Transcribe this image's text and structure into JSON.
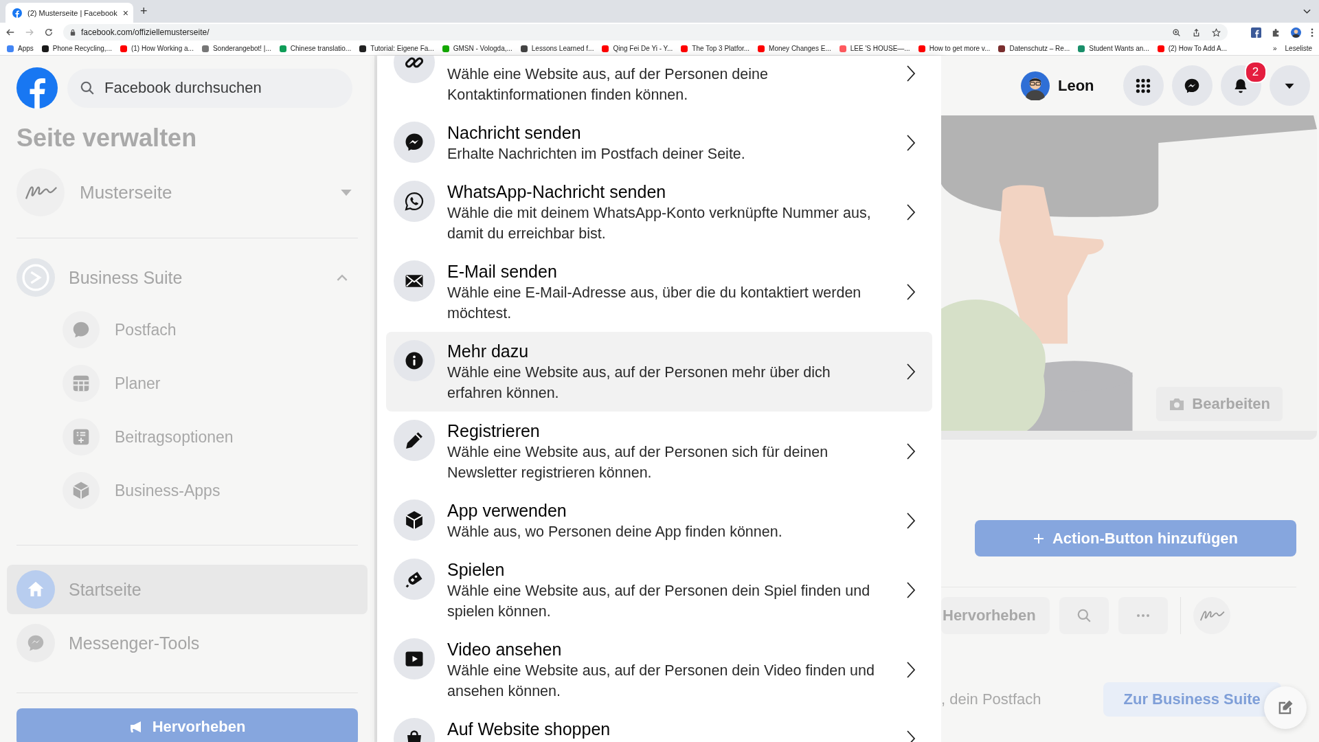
{
  "browser": {
    "tab": {
      "title": "(2) Musterseite | Facebook",
      "close": "×"
    },
    "new_tab": "+",
    "url": "facebook.com/offiziellemusterseite/",
    "bookmarks": [
      {
        "label": "Apps",
        "color": "#4285f4"
      },
      {
        "label": "Phone Recycling,...",
        "color": "#1a1a1a"
      },
      {
        "label": "(1) How Working a...",
        "color": "#ff0000"
      },
      {
        "label": "Sonderangebot! |...",
        "color": "#777777"
      },
      {
        "label": "Chinese translatio...",
        "color": "#0f9d58"
      },
      {
        "label": "Tutorial: Eigene Fa...",
        "color": "#222222"
      },
      {
        "label": "GMSN - Vologda,...",
        "color": "#14a800"
      },
      {
        "label": "Lessons Learned f...",
        "color": "#444444"
      },
      {
        "label": "Qing Fei De Yi - Y...",
        "color": "#ff0000"
      },
      {
        "label": "The Top 3 Platfor...",
        "color": "#ff0000"
      },
      {
        "label": "Money Changes E...",
        "color": "#ff0000"
      },
      {
        "label": "LEE 'S HOUSE—...",
        "color": "#ff5a5f"
      },
      {
        "label": "How to get more v...",
        "color": "#ff0000"
      },
      {
        "label": "Datenschutz – Re...",
        "color": "#7a2e2e"
      },
      {
        "label": "Student Wants an...",
        "color": "#1a8f6a"
      },
      {
        "label": "(2) How To Add A...",
        "color": "#ff0000"
      }
    ],
    "bookmarks_more": "»",
    "reading_list": "Leseliste"
  },
  "header": {
    "search": {
      "placeholder": "Facebook durchsuchen"
    },
    "user": {
      "name": "Leon"
    },
    "notifications": {
      "count": "2"
    }
  },
  "sidebar": {
    "title": "Seite verwalten",
    "page": {
      "name": "Musterseite"
    },
    "sections": [
      {
        "label": "Business Suite",
        "expanded": true,
        "children": [
          {
            "label": "Postfach"
          },
          {
            "label": "Planer"
          },
          {
            "label": "Beitragsoptionen"
          },
          {
            "label": "Business-Apps"
          }
        ]
      }
    ],
    "nav": [
      {
        "label": "Startseite",
        "selected": true
      },
      {
        "label": "Messenger-Tools",
        "selected": false
      }
    ],
    "promote_button": "Hervorheben"
  },
  "dialog": {
    "options": [
      {
        "description": "Wähle eine Website aus, auf der Personen deine Kontaktinformationen finden können.",
        "highlighted": false
      },
      {
        "title": "Nachricht senden",
        "description": "Erhalte Nachrichten im Postfach deiner Seite.",
        "highlighted": false
      },
      {
        "title": "WhatsApp-Nachricht senden",
        "description": "Wähle die mit deinem WhatsApp-Konto verknüpfte Nummer aus, damit du erreichbar bist.",
        "highlighted": false
      },
      {
        "title": "E-Mail senden",
        "description": "Wähle eine E-Mail-Adresse aus, über die du kontaktiert werden möchtest.",
        "highlighted": false
      },
      {
        "title": "Mehr dazu",
        "description": "Wähle eine Website aus, auf der Personen mehr über dich erfahren können.",
        "highlighted": true
      },
      {
        "title": "Registrieren",
        "description": "Wähle eine Website aus, auf der Personen sich für deinen Newsletter registrieren können.",
        "highlighted": false
      },
      {
        "title": "App verwenden",
        "description": "Wähle aus, wo Personen deine App finden können.",
        "highlighted": false
      },
      {
        "title": "Spielen",
        "description": "Wähle eine Website aus, auf der Personen dein Spiel finden und spielen können.",
        "highlighted": false
      },
      {
        "title": "Video ansehen",
        "description": "Wähle eine Website aus, auf der Personen dein Video finden und ansehen können.",
        "highlighted": false
      },
      {
        "title": "Auf Website shoppen",
        "highlighted": false
      }
    ]
  },
  "page": {
    "edit_cover_button": "Bearbeiten",
    "action_button": "Action-Button hinzufügen",
    "toolbar": {
      "promote_button": "Hervorheben"
    },
    "inbox_text": ", dein Postfach",
    "business_suite_button": "Zur Business Suite"
  }
}
